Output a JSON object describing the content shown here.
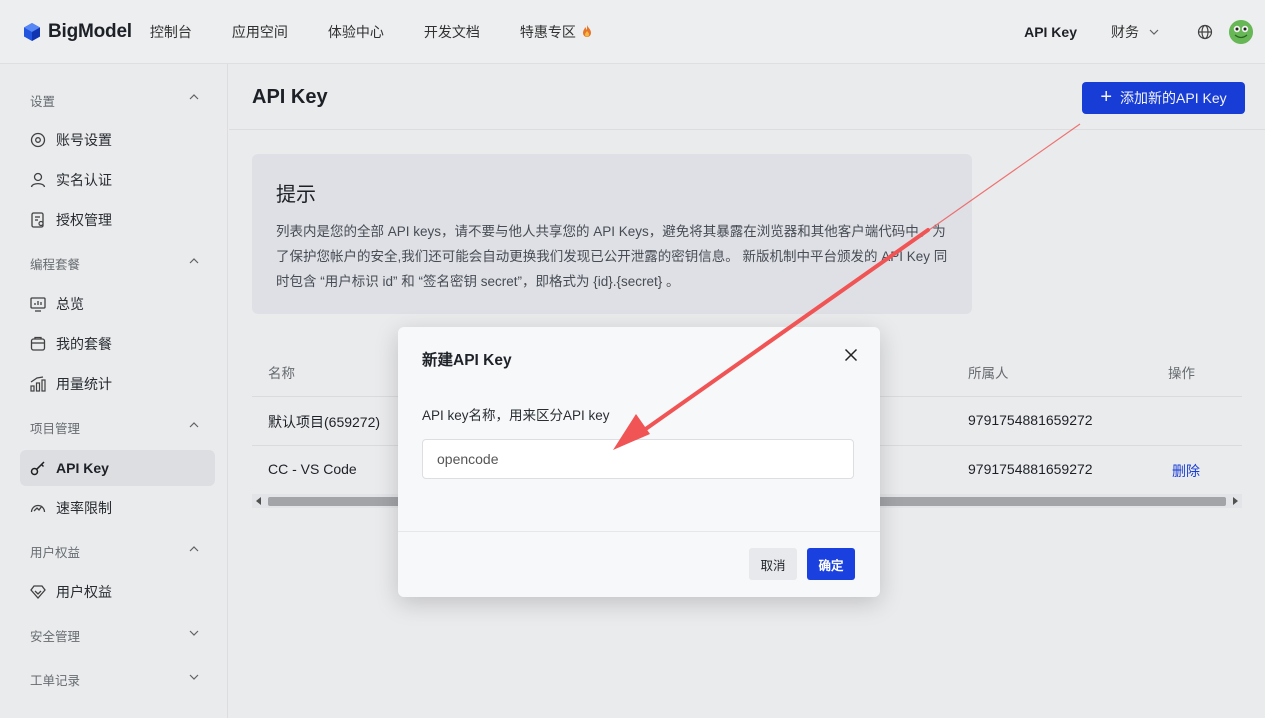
{
  "header": {
    "brand": "BigModel",
    "nav": [
      "控制台",
      "应用空间",
      "体验中心",
      "开发文档",
      "特惠专区"
    ],
    "api_key": "API Key",
    "finance": "财务"
  },
  "sidebar": {
    "sections": [
      {
        "title": "设置",
        "items": [
          "账号设置",
          "实名认证",
          "授权管理"
        ]
      },
      {
        "title": "编程套餐",
        "items": [
          "总览",
          "我的套餐",
          "用量统计"
        ]
      },
      {
        "title": "项目管理",
        "items": [
          "API Key",
          "速率限制"
        ]
      },
      {
        "title": "用户权益",
        "items": [
          "用户权益"
        ]
      },
      {
        "title": "安全管理",
        "items": []
      },
      {
        "title": "工单记录",
        "items": []
      }
    ]
  },
  "main": {
    "title": "API Key",
    "add_button": "添加新的API Key",
    "tip": {
      "title": "提示",
      "body": "列表内是您的全部 API keys，请不要与他人共享您的 API Keys，避免将其暴露在浏览器和其他客户端代码中。为了保护您帐户的安全,我们还可能会自动更换我们发现已公开泄露的密钥信息。 新版机制中平台颁发的 API Key 同时包含 “用户标识 id” 和 “签名密钥 secret”，即格式为 {id}.{secret} 。"
    },
    "table": {
      "headers": {
        "name": "名称",
        "owner": "所属人",
        "action": "操作"
      },
      "rows": [
        {
          "name": "默认项目(659272)",
          "owner": "9791754881659272",
          "action": ""
        },
        {
          "name": "CC - VS Code",
          "owner": "9791754881659272",
          "action": "删除"
        }
      ]
    }
  },
  "modal": {
    "title": "新建API Key",
    "label": "API key名称，用来区分API key",
    "input_value": "opencode",
    "cancel": "取消",
    "ok": "确定"
  },
  "colors": {
    "accent": "#1a40e0",
    "annotation_arrow": "#f05454"
  }
}
